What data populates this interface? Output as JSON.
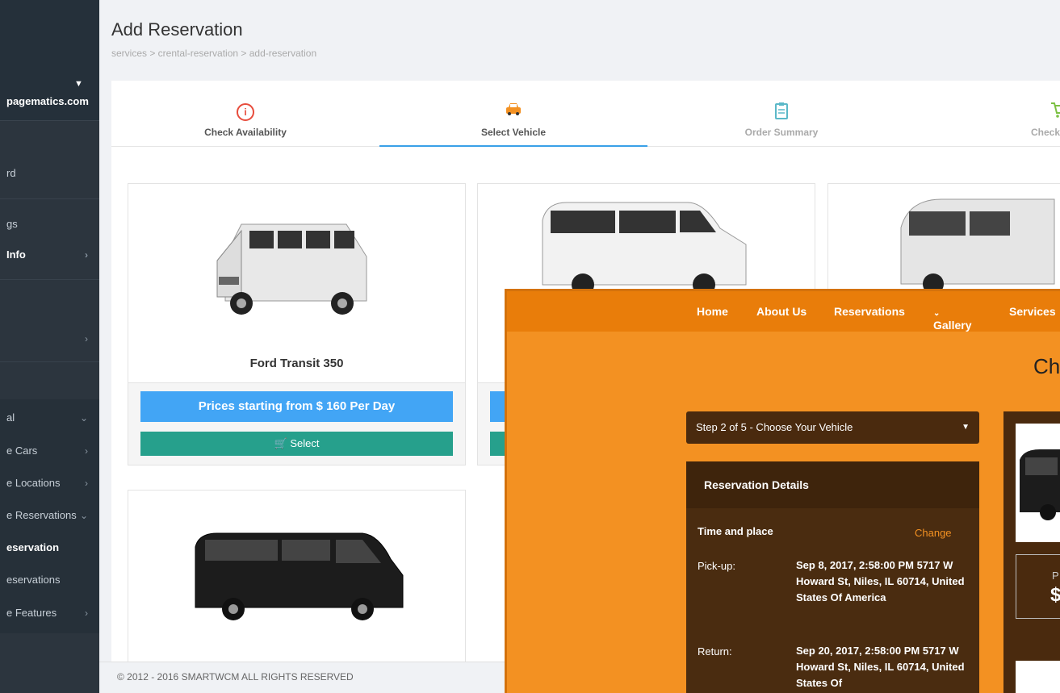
{
  "sidebar": {
    "user": "pagematics.com",
    "items": [
      {
        "label": "rd",
        "chevron": ""
      },
      {
        "label": "gs",
        "chevron": ""
      },
      {
        "label": "Info",
        "chevron": "›"
      },
      {
        "label": "",
        "chevron": "›"
      },
      {
        "label": "al",
        "chevron": "⌄"
      },
      {
        "label": "e Cars",
        "chevron": "›"
      },
      {
        "label": "e Locations",
        "chevron": "›"
      },
      {
        "label": "e Reservations",
        "chevron": "⌄"
      },
      {
        "label": "eservation",
        "chevron": ""
      },
      {
        "label": "eservations",
        "chevron": ""
      },
      {
        "label": "e Features",
        "chevron": "›"
      }
    ]
  },
  "header": {
    "title": "Add Reservation",
    "breadcrumb": "services  >  crental-reservation  >  add-reservation"
  },
  "steps": [
    {
      "label": "Check Availability"
    },
    {
      "label": "Select Vehicle"
    },
    {
      "label": "Order Summary"
    },
    {
      "label": "Check"
    }
  ],
  "vehicles": [
    {
      "name": "Ford Transit 350",
      "price": "Prices starting from $ 160 Per Day",
      "select": "Select"
    }
  ],
  "footer": "© 2012 - 2016 SMARTWCM ALL RIGHTS RESERVED",
  "overlay": {
    "nav": [
      "Home",
      "About Us",
      "Reservations",
      "Gallery",
      "Services"
    ],
    "heading": "Ch",
    "step_select": "Step 2 of 5 - Choose Your Vehicle",
    "reservation": {
      "title": "Reservation Details",
      "time_place": "Time and place",
      "change": "Change",
      "pickup_label": "Pick-up:",
      "pickup_value": "Sep 8, 2017, 2:58:00 PM 5717 W Howard St, Niles, IL 60714, United States Of America",
      "return_label": "Return:",
      "return_value": "Sep 20, 2017, 2:58:00 PM 5717 W Howard St, Niles, IL 60714, United States Of"
    },
    "side_price_prefix": "P",
    "side_price_symbol": "$"
  }
}
